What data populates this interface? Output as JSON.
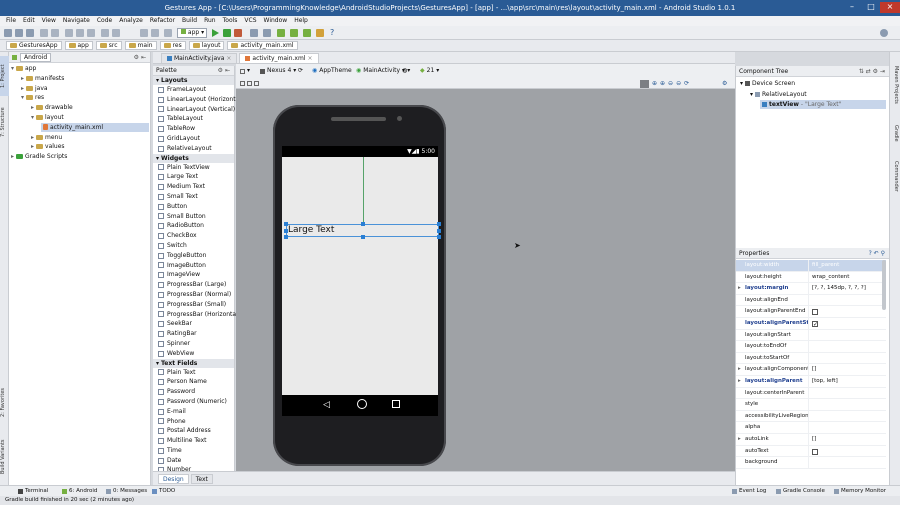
{
  "window": {
    "title": "Gestures App - [C:\\Users\\ProgrammingKnowledge\\AndroidStudioProjects\\GesturesApp] - [app] - ...\\app\\src\\main\\res\\layout\\activity_main.xml - Android Studio 1.0.1"
  },
  "menu": [
    "File",
    "Edit",
    "View",
    "Navigate",
    "Code",
    "Analyze",
    "Refactor",
    "Build",
    "Run",
    "Tools",
    "VCS",
    "Window",
    "Help"
  ],
  "toolbar": {
    "run_config": "app",
    "help": "?"
  },
  "breadcrumbs": [
    "GesturesApp",
    "app",
    "src",
    "main",
    "res",
    "layout",
    "activity_main.xml"
  ],
  "left_strip": [
    "1: Project",
    "7: Structure",
    "2: Favorites",
    "Build Variants"
  ],
  "project": {
    "view": "Android",
    "tree": [
      {
        "label": "app",
        "depth": 0,
        "open": true
      },
      {
        "label": "manifests",
        "depth": 1,
        "open": false
      },
      {
        "label": "java",
        "depth": 1,
        "open": false
      },
      {
        "label": "res",
        "depth": 1,
        "open": true
      },
      {
        "label": "drawable",
        "depth": 2,
        "open": false
      },
      {
        "label": "layout",
        "depth": 2,
        "open": true
      },
      {
        "label": "activity_main.xml",
        "depth": 3,
        "file": true
      },
      {
        "label": "menu",
        "depth": 2,
        "open": false
      },
      {
        "label": "values",
        "depth": 2,
        "open": false
      },
      {
        "label": "Gradle Scripts",
        "depth": 0,
        "open": false
      }
    ]
  },
  "editor_tabs": [
    {
      "label": "MainActivity.java",
      "active": false
    },
    {
      "label": "activity_main.xml",
      "active": true
    }
  ],
  "palette": {
    "title": "Palette",
    "groups": [
      {
        "name": "Layouts",
        "items": [
          "FrameLayout",
          "LinearLayout (Horizontal)",
          "LinearLayout (Vertical)",
          "TableLayout",
          "TableRow",
          "GridLayout",
          "RelativeLayout"
        ]
      },
      {
        "name": "Widgets",
        "items": [
          "Plain TextView",
          "Large Text",
          "Medium Text",
          "Small Text",
          "Button",
          "Small Button",
          "RadioButton",
          "CheckBox",
          "Switch",
          "ToggleButton",
          "ImageButton",
          "ImageView",
          "ProgressBar (Large)",
          "ProgressBar (Normal)",
          "ProgressBar (Small)",
          "ProgressBar (Horizontal)",
          "SeekBar",
          "RatingBar",
          "Spinner",
          "WebView"
        ]
      },
      {
        "name": "Text Fields",
        "items": [
          "Plain Text",
          "Person Name",
          "Password",
          "Password (Numeric)",
          "E-mail",
          "Phone",
          "Postal Address",
          "Multiline Text",
          "Time",
          "Date",
          "Number"
        ]
      }
    ]
  },
  "design_toolbar": {
    "device": "Nexus 4",
    "theme": "AppTheme",
    "activity": "MainActivity",
    "api": "21"
  },
  "device_screen": {
    "clock": "5:00",
    "textview_text": "Large Text"
  },
  "bottom_tabs": [
    {
      "label": "Design",
      "active": true
    },
    {
      "label": "Text",
      "active": false
    }
  ],
  "component_tree": {
    "title": "Component Tree",
    "items": [
      {
        "label": "Device Screen",
        "depth": 0
      },
      {
        "label": "RelativeLayout",
        "depth": 1
      },
      {
        "label": "textView",
        "extra": " - \"Large Text\"",
        "depth": 2,
        "selected": true
      }
    ]
  },
  "properties": {
    "title": "Properties",
    "rows": [
      {
        "key": "layout:width",
        "value": "fill_parent",
        "bold": false,
        "expand": false,
        "dim": true
      },
      {
        "key": "layout:height",
        "value": "wrap_content",
        "bold": false,
        "expand": false
      },
      {
        "key": "layout:margin",
        "value": "[?, ?, 145dp, ?, ?, ?]",
        "bold": true,
        "expand": true
      },
      {
        "key": "layout:alignEnd",
        "value": "",
        "bold": false,
        "expand": false
      },
      {
        "key": "layout:alignParentEnd",
        "value": "",
        "bold": false,
        "checkbox": "off"
      },
      {
        "key": "layout:alignParentStart",
        "value": "",
        "bold": true,
        "checkbox": "on"
      },
      {
        "key": "layout:alignStart",
        "value": "",
        "bold": false
      },
      {
        "key": "layout:toEndOf",
        "value": "",
        "bold": false
      },
      {
        "key": "layout:toStartOf",
        "value": "",
        "bold": false
      },
      {
        "key": "layout:alignComponent",
        "value": "[]",
        "bold": false,
        "expand": true
      },
      {
        "key": "layout:alignParent",
        "value": "[top, left]",
        "bold": true,
        "expand": true
      },
      {
        "key": "layout:centerInParent",
        "value": "",
        "bold": false
      },
      {
        "key": "style",
        "value": "",
        "bold": false
      },
      {
        "key": "accessibilityLiveRegion",
        "value": "",
        "bold": false
      },
      {
        "key": "alpha",
        "value": "",
        "bold": false
      },
      {
        "key": "autoLink",
        "value": "[]",
        "bold": false,
        "expand": true
      },
      {
        "key": "autoText",
        "value": "",
        "bold": false,
        "checkbox": "off"
      },
      {
        "key": "background",
        "value": "",
        "bold": false
      }
    ]
  },
  "right_strip": [
    "Maven Projects",
    "Gradle",
    "Commander"
  ],
  "bottom_bar": {
    "left": [
      "Terminal",
      "6: Android",
      "0: Messages",
      "TODO"
    ],
    "right": [
      "Event Log",
      "Gradle Console",
      "Memory Monitor"
    ]
  },
  "status": "Gradle build finished in 20 sec (2 minutes ago)",
  "colors": {
    "accent": "#2a5b95",
    "selection": "#c7d5ea",
    "handle": "#2a7fd4"
  }
}
